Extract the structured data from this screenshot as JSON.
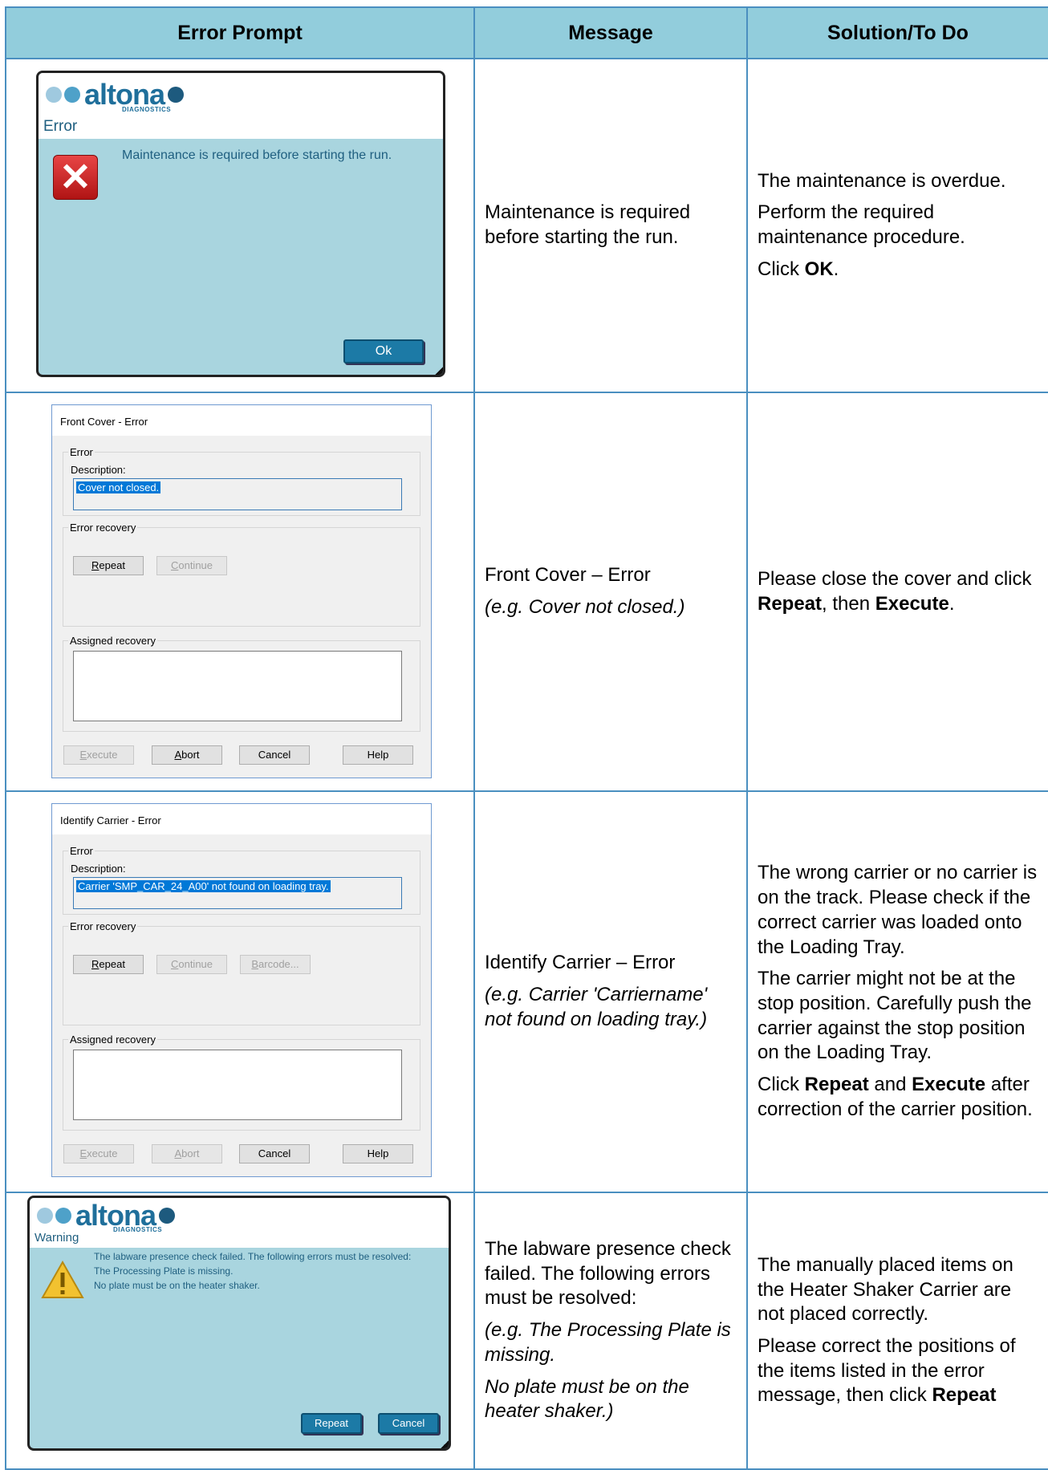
{
  "headers": {
    "prompt": "Error Prompt",
    "message": "Message",
    "solution": "Solution/To Do"
  },
  "row1": {
    "dialog": {
      "type": "Error",
      "text": "Maintenance is required before starting the run.",
      "ok": "Ok",
      "logo": "altona",
      "logo_sub": "DIAGNOSTICS"
    },
    "message": "Maintenance is required before starting the run.",
    "sol": {
      "p1": "The maintenance is overdue.",
      "p2": "Perform the required maintenance procedure.",
      "p3_pre": "Click ",
      "p3_b": "OK",
      "p3_post": "."
    }
  },
  "row2": {
    "dialog": {
      "title": "Front Cover - Error",
      "group_error": "Error",
      "description_label": "Description:",
      "description": "Cover not closed.",
      "group_recovery": "Error recovery",
      "repeat": "Repeat",
      "continue": "Continue",
      "group_assigned": "Assigned recovery",
      "execute": "Execute",
      "abort": "Abort",
      "cancel": "Cancel",
      "help": "Help"
    },
    "message": {
      "title": "Front Cover – Error",
      "example": "(e.g. Cover not closed.)"
    },
    "sol": {
      "t1": "Please close the cover and click ",
      "b1": "Repeat",
      "t2": ", then ",
      "b2": "Execute",
      "t3": "."
    }
  },
  "row3": {
    "dialog": {
      "title": "Identify Carrier - Error",
      "group_error": "Error",
      "description_label": "Description:",
      "description": "Carrier 'SMP_CAR_24_A00' not found on loading tray.",
      "group_recovery": "Error recovery",
      "repeat": "Repeat",
      "continue": "Continue",
      "barcode": "Barcode...",
      "group_assigned": "Assigned recovery",
      "execute": "Execute",
      "abort": "Abort",
      "cancel": "Cancel",
      "help": "Help"
    },
    "message": {
      "title": "Identify Carrier – Error",
      "example": "(e.g. Carrier 'Carriername' not found on loading tray.)"
    },
    "sol": {
      "p1": "The wrong carrier or no carrier is on the track. Please check if the correct carrier was loaded onto the Loading Tray.",
      "p2": "The carrier might not be at the stop position. Carefully push the carrier against the stop position on the Loading Tray.",
      "p3_pre": "Click ",
      "p3_b1": "Repeat",
      "p3_mid": " and ",
      "p3_b2": "Execute",
      "p3_post": " after correction of the carrier position."
    }
  },
  "row4": {
    "dialog": {
      "type": "Warning",
      "logo": "altona",
      "logo_sub": "DIAGNOSTICS",
      "line1": "The labware presence check failed. The following errors must be resolved:",
      "line2": "The Processing Plate is missing.",
      "line3": "No plate must be on the heater shaker.",
      "repeat": "Repeat",
      "cancel": "Cancel"
    },
    "message": {
      "p1": "The labware presence check failed. The following errors must be resolved:",
      "e1": "(e.g. The Processing Plate is missing.",
      "e2": "No plate must be on the heater shaker.)"
    },
    "sol": {
      "p1": "The manually placed items on the Heater Shaker Carrier are not placed correctly.",
      "p2_pre": "Please correct the positions of the items listed in the error message, then click ",
      "p2_b": "Repeat"
    }
  },
  "colors": {
    "header_bg": "#92cddc",
    "grid": "#4a8fc0",
    "dialog_bg": "#a9d5df",
    "brand": "#1f6f9b"
  },
  "icons": [
    "error-x-icon",
    "warning-triangle-icon"
  ]
}
